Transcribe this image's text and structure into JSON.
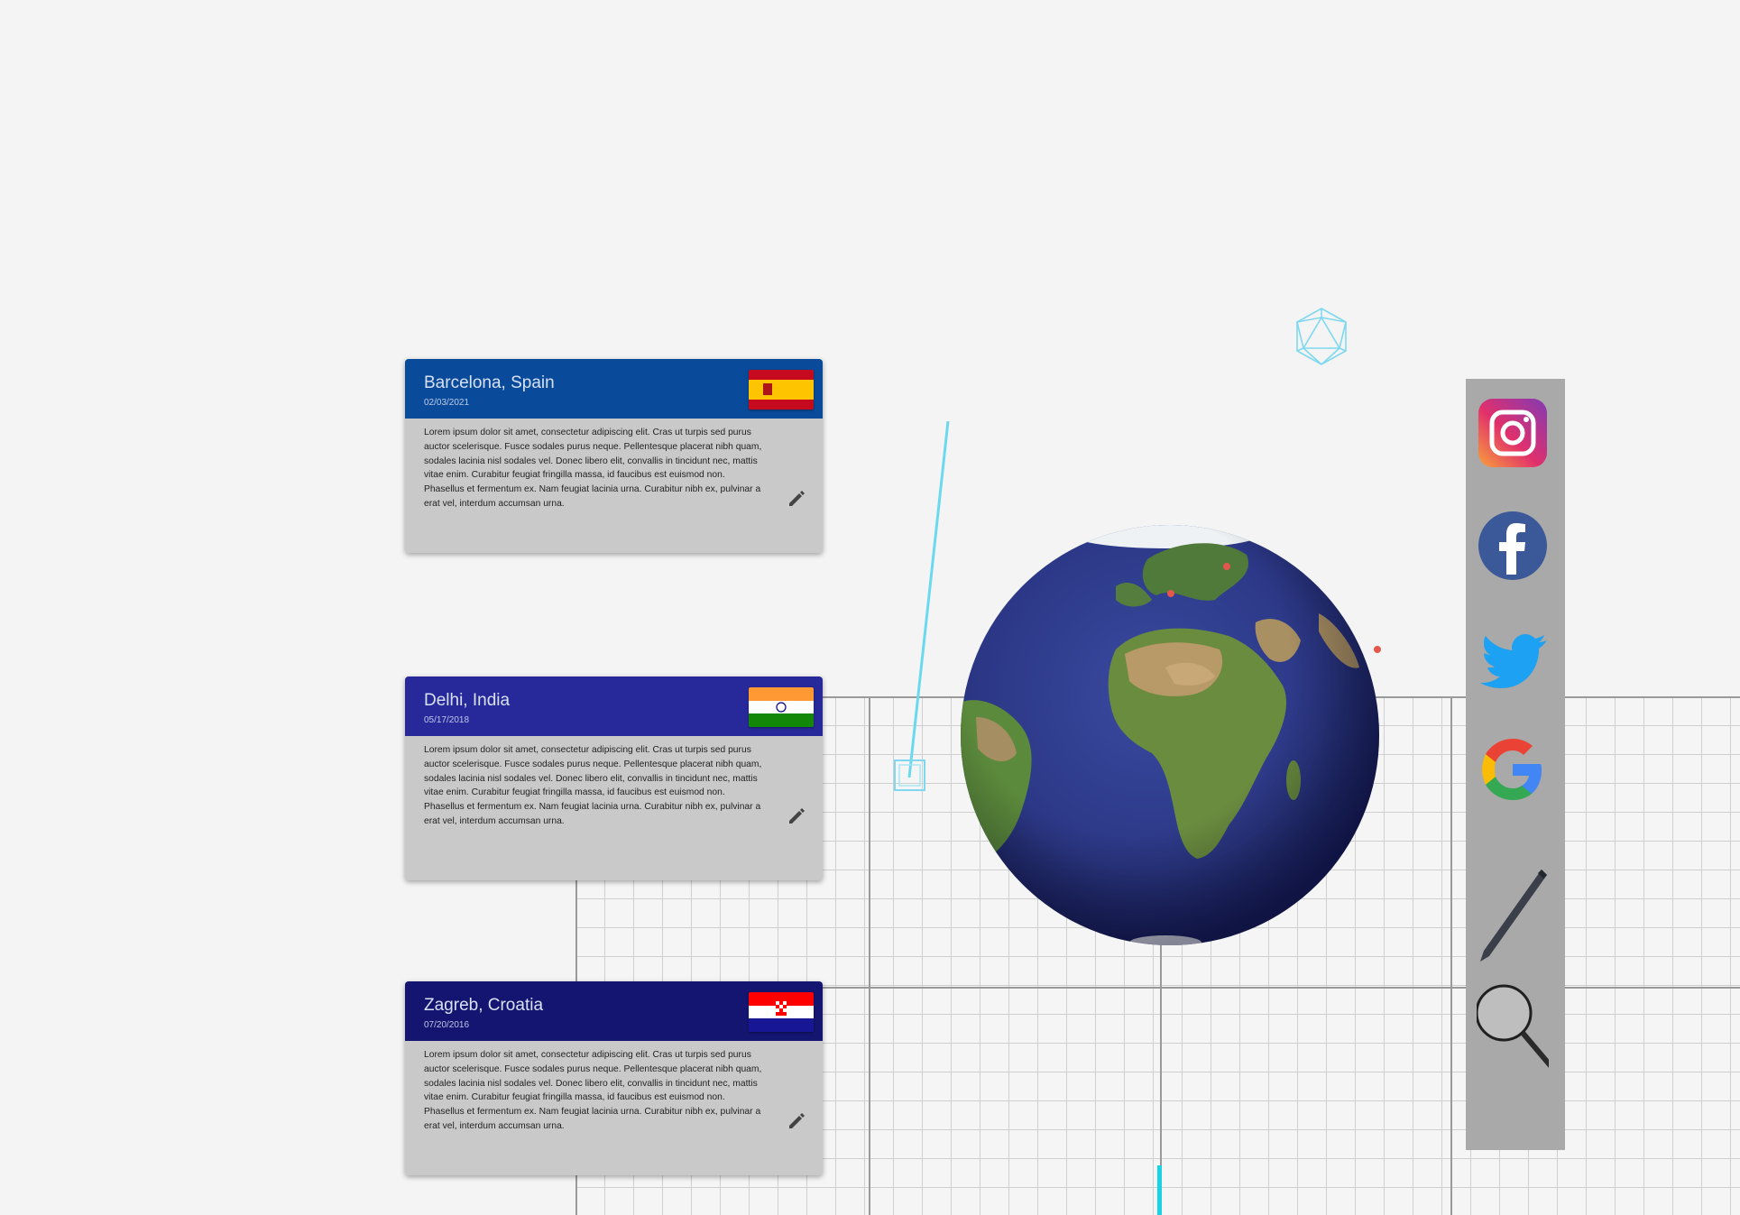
{
  "cards": [
    {
      "city": "Barcelona, Spain",
      "date": "02/03/2021",
      "flag": "spain-flag",
      "header_color": "#0a4a9a",
      "text": "Lorem ipsum dolor sit amet, consectetur adipiscing elit. Cras ut turpis sed purus auctor scelerisque. Fusce sodales purus neque. Pellentesque placerat nibh quam, sodales lacinia nisl sodales vel. Donec libero elit, convallis in tincidunt nec, mattis vitae enim. Curabitur feugiat fringilla massa, id faucibus est euismod non. Phasellus et fermentum ex. Nam feugiat lacinia urna. Curabitur nibh ex, pulvinar a erat vel, interdum accumsan urna."
    },
    {
      "city": "Delhi, India",
      "date": "05/17/2018",
      "flag": "india-flag",
      "header_color": "#27299a",
      "text": "Lorem ipsum dolor sit amet, consectetur adipiscing elit. Cras ut turpis sed purus auctor scelerisque. Fusce sodales purus neque. Pellentesque placerat nibh quam, sodales lacinia nisl sodales vel. Donec libero elit, convallis in tincidunt nec, mattis vitae enim. Curabitur feugiat fringilla massa, id faucibus est euismod non. Phasellus et fermentum ex. Nam feugiat lacinia urna. Curabitur nibh ex, pulvinar a erat vel, interdum accumsan urna."
    },
    {
      "city": "Zagreb, Croatia",
      "date": "07/20/2016",
      "flag": "croatia-flag",
      "header_color": "#141570",
      "text": "Lorem ipsum dolor sit amet, consectetur adipiscing elit. Cras ut turpis sed purus auctor scelerisque. Fusce sodales purus neque. Pellentesque placerat nibh quam, sodales lacinia nisl sodales vel. Donec libero elit, convallis in tincidunt nec, mattis vitae enim. Curabitur feugiat fringilla massa, id faucibus est euismod non. Phasellus et fermentum ex. Nam feugiat lacinia urna. Curabitur nibh ex, pulvinar a erat vel, interdum accumsan urna."
    }
  ],
  "toolbar": {
    "items": [
      "instagram-icon",
      "facebook-icon",
      "twitter-icon",
      "google-icon",
      "pen-icon",
      "magnifier-icon"
    ]
  },
  "colors": {
    "background": "#f4f4f4",
    "laser": "#5fd3ec",
    "ocean": "#2f3f8c",
    "toolbar": "#a9a9a9"
  }
}
